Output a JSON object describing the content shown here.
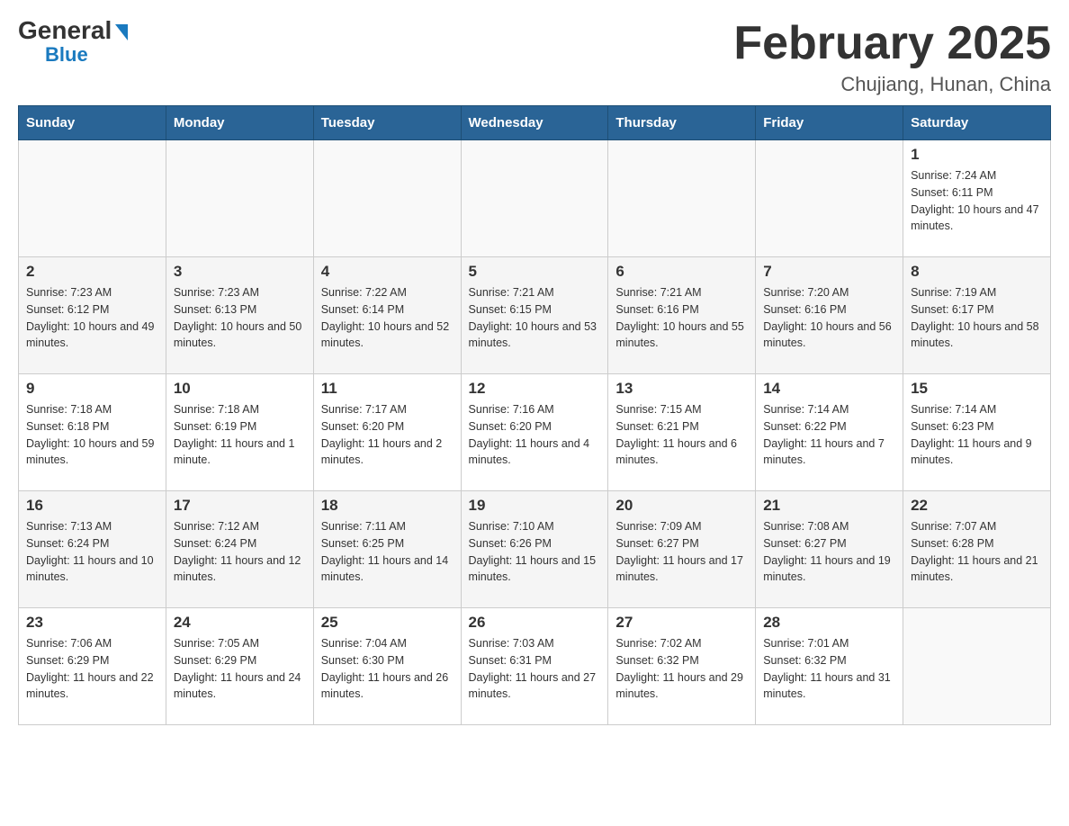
{
  "header": {
    "logo_general": "General",
    "logo_blue": "Blue",
    "month_title": "February 2025",
    "location": "Chujiang, Hunan, China"
  },
  "weekdays": [
    "Sunday",
    "Monday",
    "Tuesday",
    "Wednesday",
    "Thursday",
    "Friday",
    "Saturday"
  ],
  "weeks": [
    [
      {
        "day": "",
        "info": ""
      },
      {
        "day": "",
        "info": ""
      },
      {
        "day": "",
        "info": ""
      },
      {
        "day": "",
        "info": ""
      },
      {
        "day": "",
        "info": ""
      },
      {
        "day": "",
        "info": ""
      },
      {
        "day": "1",
        "info": "Sunrise: 7:24 AM\nSunset: 6:11 PM\nDaylight: 10 hours and 47 minutes."
      }
    ],
    [
      {
        "day": "2",
        "info": "Sunrise: 7:23 AM\nSunset: 6:12 PM\nDaylight: 10 hours and 49 minutes."
      },
      {
        "day": "3",
        "info": "Sunrise: 7:23 AM\nSunset: 6:13 PM\nDaylight: 10 hours and 50 minutes."
      },
      {
        "day": "4",
        "info": "Sunrise: 7:22 AM\nSunset: 6:14 PM\nDaylight: 10 hours and 52 minutes."
      },
      {
        "day": "5",
        "info": "Sunrise: 7:21 AM\nSunset: 6:15 PM\nDaylight: 10 hours and 53 minutes."
      },
      {
        "day": "6",
        "info": "Sunrise: 7:21 AM\nSunset: 6:16 PM\nDaylight: 10 hours and 55 minutes."
      },
      {
        "day": "7",
        "info": "Sunrise: 7:20 AM\nSunset: 6:16 PM\nDaylight: 10 hours and 56 minutes."
      },
      {
        "day": "8",
        "info": "Sunrise: 7:19 AM\nSunset: 6:17 PM\nDaylight: 10 hours and 58 minutes."
      }
    ],
    [
      {
        "day": "9",
        "info": "Sunrise: 7:18 AM\nSunset: 6:18 PM\nDaylight: 10 hours and 59 minutes."
      },
      {
        "day": "10",
        "info": "Sunrise: 7:18 AM\nSunset: 6:19 PM\nDaylight: 11 hours and 1 minute."
      },
      {
        "day": "11",
        "info": "Sunrise: 7:17 AM\nSunset: 6:20 PM\nDaylight: 11 hours and 2 minutes."
      },
      {
        "day": "12",
        "info": "Sunrise: 7:16 AM\nSunset: 6:20 PM\nDaylight: 11 hours and 4 minutes."
      },
      {
        "day": "13",
        "info": "Sunrise: 7:15 AM\nSunset: 6:21 PM\nDaylight: 11 hours and 6 minutes."
      },
      {
        "day": "14",
        "info": "Sunrise: 7:14 AM\nSunset: 6:22 PM\nDaylight: 11 hours and 7 minutes."
      },
      {
        "day": "15",
        "info": "Sunrise: 7:14 AM\nSunset: 6:23 PM\nDaylight: 11 hours and 9 minutes."
      }
    ],
    [
      {
        "day": "16",
        "info": "Sunrise: 7:13 AM\nSunset: 6:24 PM\nDaylight: 11 hours and 10 minutes."
      },
      {
        "day": "17",
        "info": "Sunrise: 7:12 AM\nSunset: 6:24 PM\nDaylight: 11 hours and 12 minutes."
      },
      {
        "day": "18",
        "info": "Sunrise: 7:11 AM\nSunset: 6:25 PM\nDaylight: 11 hours and 14 minutes."
      },
      {
        "day": "19",
        "info": "Sunrise: 7:10 AM\nSunset: 6:26 PM\nDaylight: 11 hours and 15 minutes."
      },
      {
        "day": "20",
        "info": "Sunrise: 7:09 AM\nSunset: 6:27 PM\nDaylight: 11 hours and 17 minutes."
      },
      {
        "day": "21",
        "info": "Sunrise: 7:08 AM\nSunset: 6:27 PM\nDaylight: 11 hours and 19 minutes."
      },
      {
        "day": "22",
        "info": "Sunrise: 7:07 AM\nSunset: 6:28 PM\nDaylight: 11 hours and 21 minutes."
      }
    ],
    [
      {
        "day": "23",
        "info": "Sunrise: 7:06 AM\nSunset: 6:29 PM\nDaylight: 11 hours and 22 minutes."
      },
      {
        "day": "24",
        "info": "Sunrise: 7:05 AM\nSunset: 6:29 PM\nDaylight: 11 hours and 24 minutes."
      },
      {
        "day": "25",
        "info": "Sunrise: 7:04 AM\nSunset: 6:30 PM\nDaylight: 11 hours and 26 minutes."
      },
      {
        "day": "26",
        "info": "Sunrise: 7:03 AM\nSunset: 6:31 PM\nDaylight: 11 hours and 27 minutes."
      },
      {
        "day": "27",
        "info": "Sunrise: 7:02 AM\nSunset: 6:32 PM\nDaylight: 11 hours and 29 minutes."
      },
      {
        "day": "28",
        "info": "Sunrise: 7:01 AM\nSunset: 6:32 PM\nDaylight: 11 hours and 31 minutes."
      },
      {
        "day": "",
        "info": ""
      }
    ]
  ]
}
